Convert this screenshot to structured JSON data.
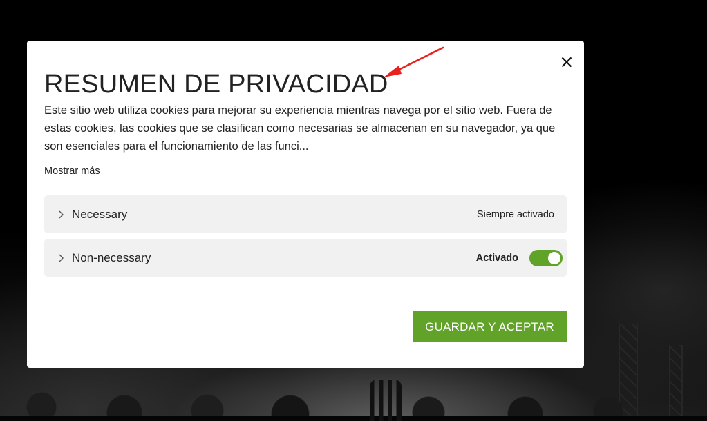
{
  "modal": {
    "title": "RESUMEN DE PRIVACIDAD",
    "description": "Este sitio web utiliza cookies para mejorar su experiencia mientras navega por el sitio web. Fuera de estas cookies, las cookies que se clasifican como necesarias se almacenan en su navegador, ya que son esenciales para el funcionamiento de las funci...",
    "show_more_label": "Mostrar más",
    "close_icon": "close-icon",
    "categories": [
      {
        "label": "Necessary",
        "status": "Siempre activado",
        "icon": "chevron-right-icon"
      },
      {
        "label": "Non-necessary",
        "status": "Activado",
        "icon": "chevron-right-icon",
        "toggle_on": true
      }
    ],
    "save_button_label": "GUARDAR Y ACEPTAR"
  },
  "colors": {
    "accent_green": "#61a229",
    "annotation_arrow": "#e8211c",
    "panel_bg": "#f1f1f1",
    "overlay_bg": "#050505"
  }
}
